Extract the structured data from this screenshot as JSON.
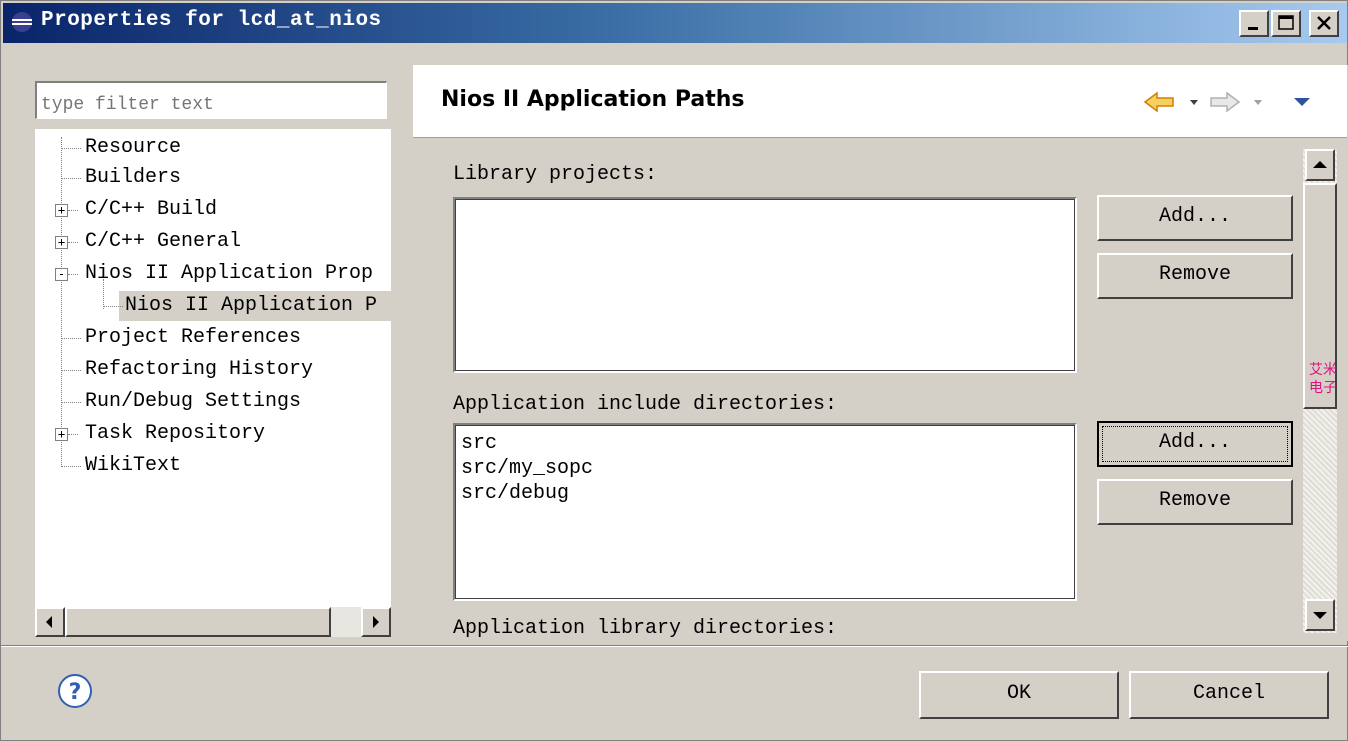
{
  "window": {
    "title": "Properties for lcd_at_nios",
    "controls": [
      "minimize",
      "maximize",
      "close"
    ]
  },
  "filter": {
    "placeholder": "type filter text"
  },
  "tree": {
    "items": [
      {
        "label": "Resource",
        "expander": ""
      },
      {
        "label": "Builders",
        "expander": ""
      },
      {
        "label": "C/C++ Build",
        "expander": "+"
      },
      {
        "label": "C/C++ General",
        "expander": "+"
      },
      {
        "label": "Nios II Application Prop",
        "expander": "-"
      },
      {
        "label": "Nios II Application P",
        "expander": "",
        "selected": true
      },
      {
        "label": "Project References",
        "expander": ""
      },
      {
        "label": "Refactoring History",
        "expander": ""
      },
      {
        "label": "Run/Debug Settings",
        "expander": ""
      },
      {
        "label": "Task Repository",
        "expander": "+"
      },
      {
        "label": "WikiText",
        "expander": ""
      }
    ]
  },
  "page": {
    "title": "Nios II Application Paths",
    "nav_icons": [
      "back-arrow-icon",
      "dropdown-icon",
      "forward-arrow-icon",
      "dropdown-icon",
      "view-menu-icon"
    ],
    "library_projects": {
      "label": "Library projects:",
      "items": [],
      "add_label": "Add...",
      "remove_label": "Remove"
    },
    "include_dirs": {
      "label": "Application include directories:",
      "items": [
        "src",
        "src/my_sopc",
        "src/debug"
      ],
      "add_label": "Add...",
      "remove_label": "Remove"
    },
    "library_dirs": {
      "label": "Application library directories:"
    }
  },
  "footer": {
    "ok_label": "OK",
    "cancel_label": "Cancel"
  },
  "watermark": {
    "line1": "艾米",
    "line2": "电子"
  },
  "colors": {
    "title_gradient_start": "#0a246a",
    "title_gradient_end": "#a6caf0",
    "dialog_bg": "#d4d0c8",
    "arrow_orange": "#f0a020"
  }
}
